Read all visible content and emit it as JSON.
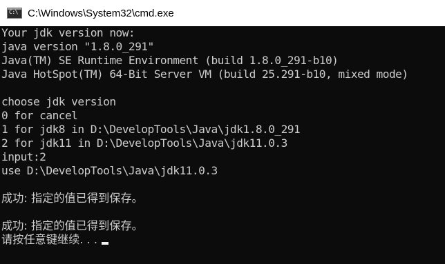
{
  "window": {
    "title": "C:\\Windows\\System32\\cmd.exe",
    "icon_label": "C:\\",
    "icon": "cmd-icon"
  },
  "console": {
    "lines": [
      "Your jdk version now:",
      "java version \"1.8.0_291\"",
      "Java(TM) SE Runtime Environment (build 1.8.0_291-b10)",
      "Java HotSpot(TM) 64-Bit Server VM (build 25.291-b10, mixed mode)",
      "",
      "choose jdk version",
      "0 for cancel",
      "1 for jdk8 in D:\\DevelopTools\\Java\\jdk1.8.0_291",
      "2 for jdk11 in D:\\DevelopTools\\Java\\jdk11.0.3",
      "input:2",
      "use D:\\DevelopTools\\Java\\jdk11.0.3",
      "",
      "成功: 指定的值已得到保存。",
      "",
      "成功: 指定的值已得到保存。",
      "请按任意键继续. . ."
    ]
  },
  "colors": {
    "background": "#0c0c0c",
    "text": "#cccccc",
    "titlebar": "#ffffff"
  }
}
